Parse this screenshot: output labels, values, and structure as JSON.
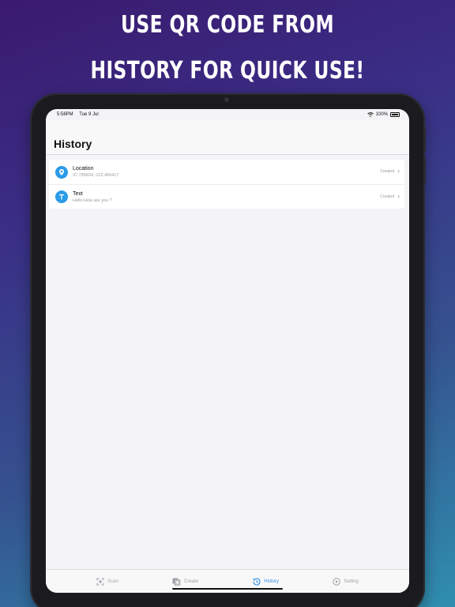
{
  "promo": {
    "line1": "USE QR CODE FROM",
    "line2": "HISTORY FOR QUICK USE!"
  },
  "status_bar": {
    "time": "5:58PM",
    "date": "Tue 9 Jul",
    "battery": "100%"
  },
  "nav": {
    "title": "History"
  },
  "history": {
    "items": [
      {
        "icon": "location-pin-icon",
        "title": "Location",
        "subtitle": "37.785834,-122.406417",
        "status": "Created"
      },
      {
        "icon": "text-icon",
        "title": "Text",
        "subtitle": "Hello How are you ?",
        "status": "Created"
      }
    ]
  },
  "tabs": [
    {
      "label": "Scan",
      "icon": "scan-icon",
      "active": false
    },
    {
      "label": "Create",
      "icon": "create-icon",
      "active": false
    },
    {
      "label": "History",
      "icon": "history-icon",
      "active": true
    },
    {
      "label": "Setting",
      "icon": "setting-icon",
      "active": false
    }
  ],
  "colors": {
    "accent": "#2c8ee6",
    "icon_bg": "#2c9be8"
  }
}
